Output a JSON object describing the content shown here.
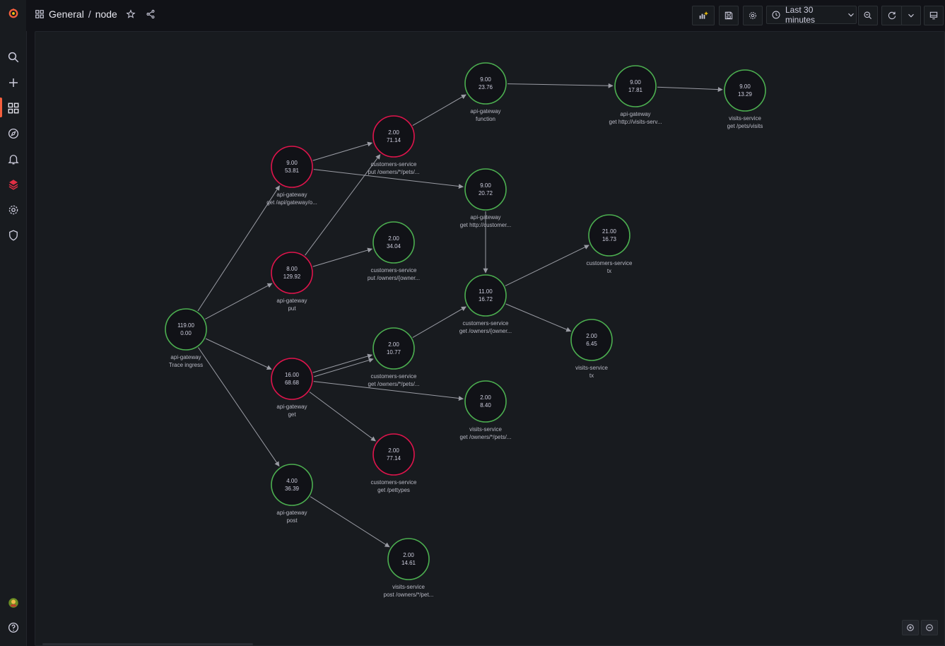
{
  "topbar": {
    "breadcrumb_folder": "General",
    "breadcrumb_separator": "/",
    "breadcrumb_dashboard": "node",
    "time_range": "Last 30 minutes"
  },
  "colors": {
    "node_ok": "#4caf50",
    "node_error": "#e0144c",
    "edge": "#9a9ca4",
    "brand": "#f55f3e"
  },
  "sidebar": {
    "items": [
      "grafana-logo",
      "search-icon",
      "plus-icon",
      "dashboards-icon",
      "explore-icon",
      "alerting-icon",
      "plugin-app-icon",
      "gear-icon",
      "shield-icon",
      "user-avatar",
      "help-icon"
    ]
  },
  "node_graph": {
    "nodes": [
      {
        "id": "n0",
        "stat1": "119.00",
        "stat2": "0.00",
        "title": "api-gateway",
        "subtitle": "Trace ingress",
        "status": "ok"
      },
      {
        "id": "n1",
        "stat1": "9.00",
        "stat2": "53.81",
        "title": "api-gateway",
        "subtitle": "get /api/gateway/o...",
        "status": "error"
      },
      {
        "id": "n2",
        "stat1": "8.00",
        "stat2": "129.92",
        "title": "api-gateway",
        "subtitle": "put",
        "status": "error"
      },
      {
        "id": "n3",
        "stat1": "16.00",
        "stat2": "68.68",
        "title": "api-gateway",
        "subtitle": "get",
        "status": "error"
      },
      {
        "id": "n4",
        "stat1": "4.00",
        "stat2": "36.39",
        "title": "api-gateway",
        "subtitle": "post",
        "status": "ok"
      },
      {
        "id": "n5",
        "stat1": "2.00",
        "stat2": "71.14",
        "title": "customers-service",
        "subtitle": "put /owners/*/pets/...",
        "status": "error"
      },
      {
        "id": "n6",
        "stat1": "2.00",
        "stat2": "34.04",
        "title": "customers-service",
        "subtitle": "put /owners/{owner...",
        "status": "ok"
      },
      {
        "id": "n7",
        "stat1": "2.00",
        "stat2": "10.77",
        "title": "customers-service",
        "subtitle": "get /owners/*/pets/...",
        "status": "ok"
      },
      {
        "id": "n8",
        "stat1": "2.00",
        "stat2": "77.14",
        "title": "customers-service",
        "subtitle": "get /pettypes",
        "status": "error"
      },
      {
        "id": "n9",
        "stat1": "2.00",
        "stat2": "14.61",
        "title": "visits-service",
        "subtitle": "post /owners/*/pet...",
        "status": "ok"
      },
      {
        "id": "n10",
        "stat1": "9.00",
        "stat2": "23.76",
        "title": "api-gateway",
        "subtitle": "function",
        "status": "ok"
      },
      {
        "id": "n11",
        "stat1": "9.00",
        "stat2": "20.72",
        "title": "api-gateway",
        "subtitle": "get http://customer...",
        "status": "ok"
      },
      {
        "id": "n12",
        "stat1": "11.00",
        "stat2": "16.72",
        "title": "customers-service",
        "subtitle": "get /owners/{owner...",
        "status": "ok"
      },
      {
        "id": "n13",
        "stat1": "2.00",
        "stat2": "8.40",
        "title": "visits-service",
        "subtitle": "get /owners/*/pets/...",
        "status": "ok"
      },
      {
        "id": "n14",
        "stat1": "9.00",
        "stat2": "17.81",
        "title": "api-gateway",
        "subtitle": "get http://visits-serv...",
        "status": "ok"
      },
      {
        "id": "n15",
        "stat1": "9.00",
        "stat2": "13.29",
        "title": "visits-service",
        "subtitle": "get /pets/visits",
        "status": "ok"
      },
      {
        "id": "n16",
        "stat1": "21.00",
        "stat2": "16.73",
        "title": "customers-service",
        "subtitle": "tx",
        "status": "ok"
      },
      {
        "id": "n17",
        "stat1": "2.00",
        "stat2": "6.45",
        "title": "visits-service",
        "subtitle": "tx",
        "status": "ok"
      }
    ],
    "edges": [
      [
        "n0",
        "n1"
      ],
      [
        "n0",
        "n2"
      ],
      [
        "n0",
        "n3"
      ],
      [
        "n0",
        "n4"
      ],
      [
        "n1",
        "n5"
      ],
      [
        "n1",
        "n11"
      ],
      [
        "n2",
        "n5"
      ],
      [
        "n2",
        "n6"
      ],
      [
        "n3",
        "n7"
      ],
      [
        "n3",
        "n7"
      ],
      [
        "n3",
        "n13"
      ],
      [
        "n3",
        "n8"
      ],
      [
        "n4",
        "n9"
      ],
      [
        "n5",
        "n10"
      ],
      [
        "n10",
        "n14"
      ],
      [
        "n14",
        "n15"
      ],
      [
        "n11",
        "n12"
      ],
      [
        "n7",
        "n12"
      ],
      [
        "n12",
        "n16"
      ],
      [
        "n12",
        "n17"
      ]
    ]
  }
}
